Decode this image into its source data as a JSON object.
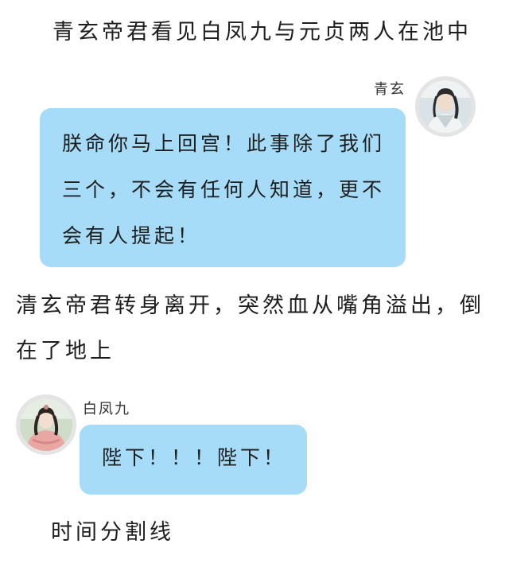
{
  "narration": {
    "line1": "青玄帝君看见白凤九与元贞两人在池中",
    "line2": "清玄帝君转身离开，突然血从嘴角溢出，倒在了地上",
    "line3": "时间分割线"
  },
  "messages": [
    {
      "sender": "青玄",
      "side": "right",
      "text": "朕命你马上回宫！此事除了我们三个，不会有任何人知道，更不会有人提起！"
    },
    {
      "sender": "白凤九",
      "side": "left",
      "text": "陛下！！！陛下！"
    }
  ],
  "colors": {
    "bubble": "#a6dcf8",
    "avatar_border": "#e4e4e4"
  }
}
